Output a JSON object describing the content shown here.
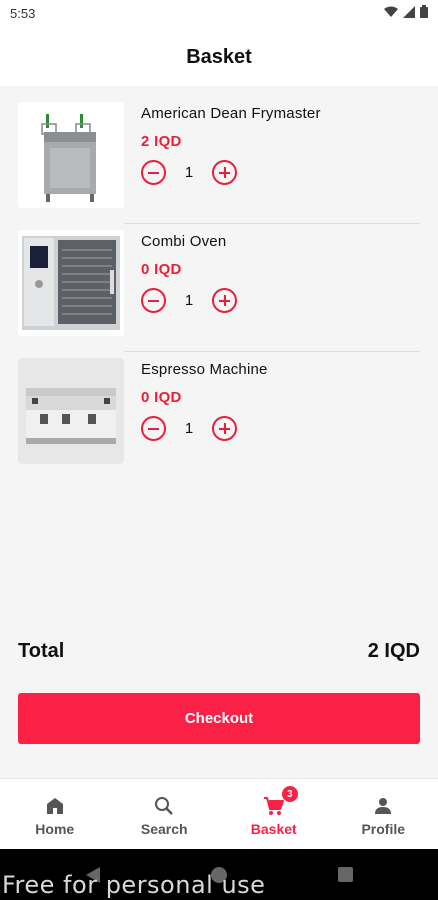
{
  "status_bar": {
    "time": "5:53"
  },
  "header": {
    "title": "Basket"
  },
  "items": [
    {
      "name": "American Dean Frymaster",
      "price": "2 IQD",
      "quantity": "1",
      "image": "deep-fryer"
    },
    {
      "name": "Combi Oven",
      "price": "0 IQD",
      "quantity": "1",
      "image": "combi-oven"
    },
    {
      "name": "Espresso Machine",
      "price": "0 IQD",
      "quantity": "1",
      "image": "espresso-machine"
    }
  ],
  "summary": {
    "total_label": "Total",
    "total_value": "2 IQD"
  },
  "checkout": {
    "label": "Checkout"
  },
  "bottom_nav": {
    "items": [
      {
        "label": "Home",
        "icon": "home-icon"
      },
      {
        "label": "Search",
        "icon": "search-icon"
      },
      {
        "label": "Basket",
        "icon": "cart-icon",
        "badge": "3",
        "active": true
      },
      {
        "label": "Profile",
        "icon": "person-icon"
      }
    ]
  },
  "watermark": {
    "text": "Free for personal use"
  },
  "colors": {
    "accent": "#fb2045",
    "price": "#e8203b",
    "background": "#f5f5f5"
  }
}
